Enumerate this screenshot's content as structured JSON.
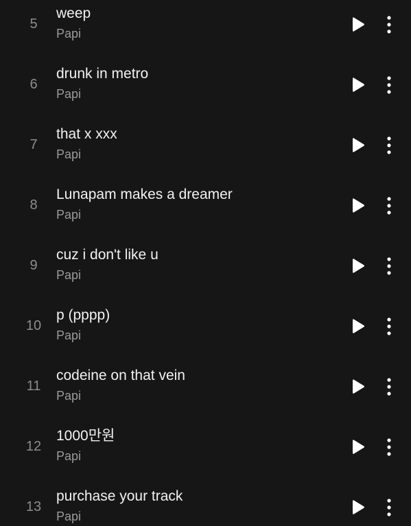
{
  "tracks": [
    {
      "number": "5",
      "title": "weep",
      "artist": "Papi"
    },
    {
      "number": "6",
      "title": "drunk in metro",
      "artist": "Papi"
    },
    {
      "number": "7",
      "title": "that x xxx",
      "artist": "Papi"
    },
    {
      "number": "8",
      "title": "Lunapam makes a dreamer",
      "artist": "Papi"
    },
    {
      "number": "9",
      "title": "cuz i don't like u",
      "artist": "Papi"
    },
    {
      "number": "10",
      "title": "p (pppp)",
      "artist": "Papi"
    },
    {
      "number": "11",
      "title": "codeine on that vein",
      "artist": "Papi"
    },
    {
      "number": "12",
      "title": "1000만원",
      "artist": "Papi"
    },
    {
      "number": "13",
      "title": "purchase your track",
      "artist": "Papi"
    }
  ],
  "icons": {
    "play": "play-icon",
    "more": "more-vertical-icon"
  },
  "colors": {
    "background": "#161616",
    "title": "#f2f2f2",
    "artist": "#9a9a9a",
    "number": "#8d8d8d",
    "icon": "#ffffff"
  }
}
